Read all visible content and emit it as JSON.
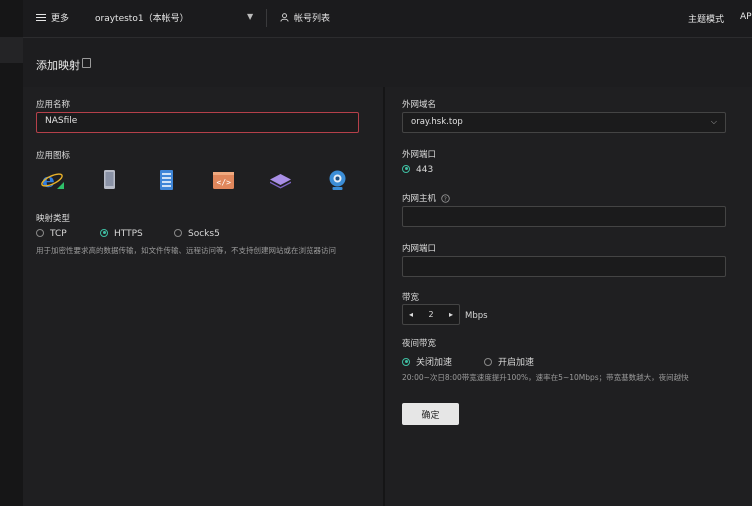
{
  "topbar": {
    "menu_label": "更多",
    "account": "oraytesto1（本帐号）",
    "account_list": "帐号列表",
    "theme": "主题模式",
    "api": "AP"
  },
  "page": {
    "title": "添加映射"
  },
  "left": {
    "app_name_label": "应用名称",
    "app_name_value": "NASfile",
    "app_icon_label": "应用图标",
    "app_icons": [
      "ie-icon",
      "phone-icon",
      "server-icon",
      "code-icon",
      "stack-icon",
      "webcam-icon"
    ],
    "mapping_type_label": "映射类型",
    "types": [
      "TCP",
      "HTTPS",
      "Socks5"
    ],
    "selected_type": "HTTPS",
    "type_hint": "用于加密性要求高的数据传输，如文件传输、远程访问等，不支持创建网站或在浏览器访问"
  },
  "right": {
    "domain_label": "外网域名",
    "domain_value": "oray.hsk.top",
    "ext_port_label": "外网端口",
    "ext_port_value": "443",
    "int_host_label": "内网主机",
    "int_port_label": "内网端口",
    "bandwidth_label": "带宽",
    "bandwidth_value": "2",
    "bandwidth_unit": "Mbps",
    "night_label": "夜间带宽",
    "night_opts": [
      "关闭加速",
      "开启加速"
    ],
    "night_selected": "关闭加速",
    "night_hint": "20:00~次日8:00带宽速度提升100%，速率在5~10Mbps；带宽基数越大，夜间越快",
    "confirm": "确定"
  },
  "colors": {
    "accent": "#3fbfa3",
    "error_border": "#b5404a"
  }
}
